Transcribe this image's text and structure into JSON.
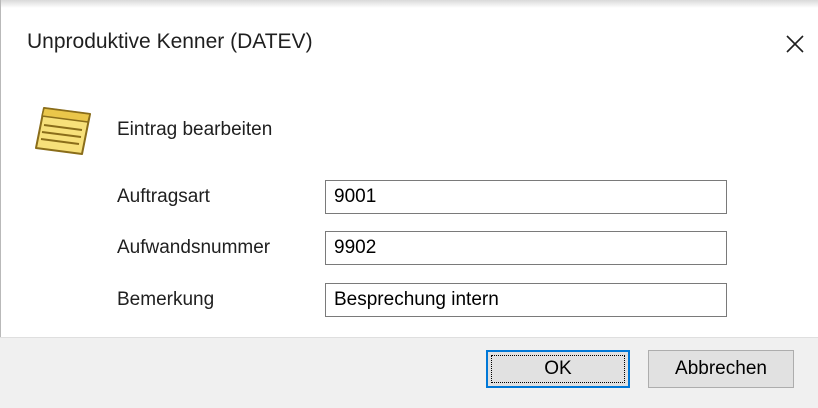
{
  "dialog": {
    "title": "Unproduktive Kenner (DATEV)",
    "close_icon": "close-icon",
    "note_icon": "notepad-icon",
    "heading": "Eintrag bearbeiten"
  },
  "form": {
    "fields": [
      {
        "label": "Auftragsart",
        "value": "9001"
      },
      {
        "label": "Aufwandsnummer",
        "value": "9902"
      },
      {
        "label": "Bemerkung",
        "value": "Besprechung intern"
      }
    ]
  },
  "buttons": {
    "ok_label": "OK",
    "cancel_label": "Abbrechen"
  },
  "colors": {
    "accent_focus": "#0078d7",
    "footer_bg": "#f0f0f0",
    "note_yellow": "#f7e07a"
  }
}
